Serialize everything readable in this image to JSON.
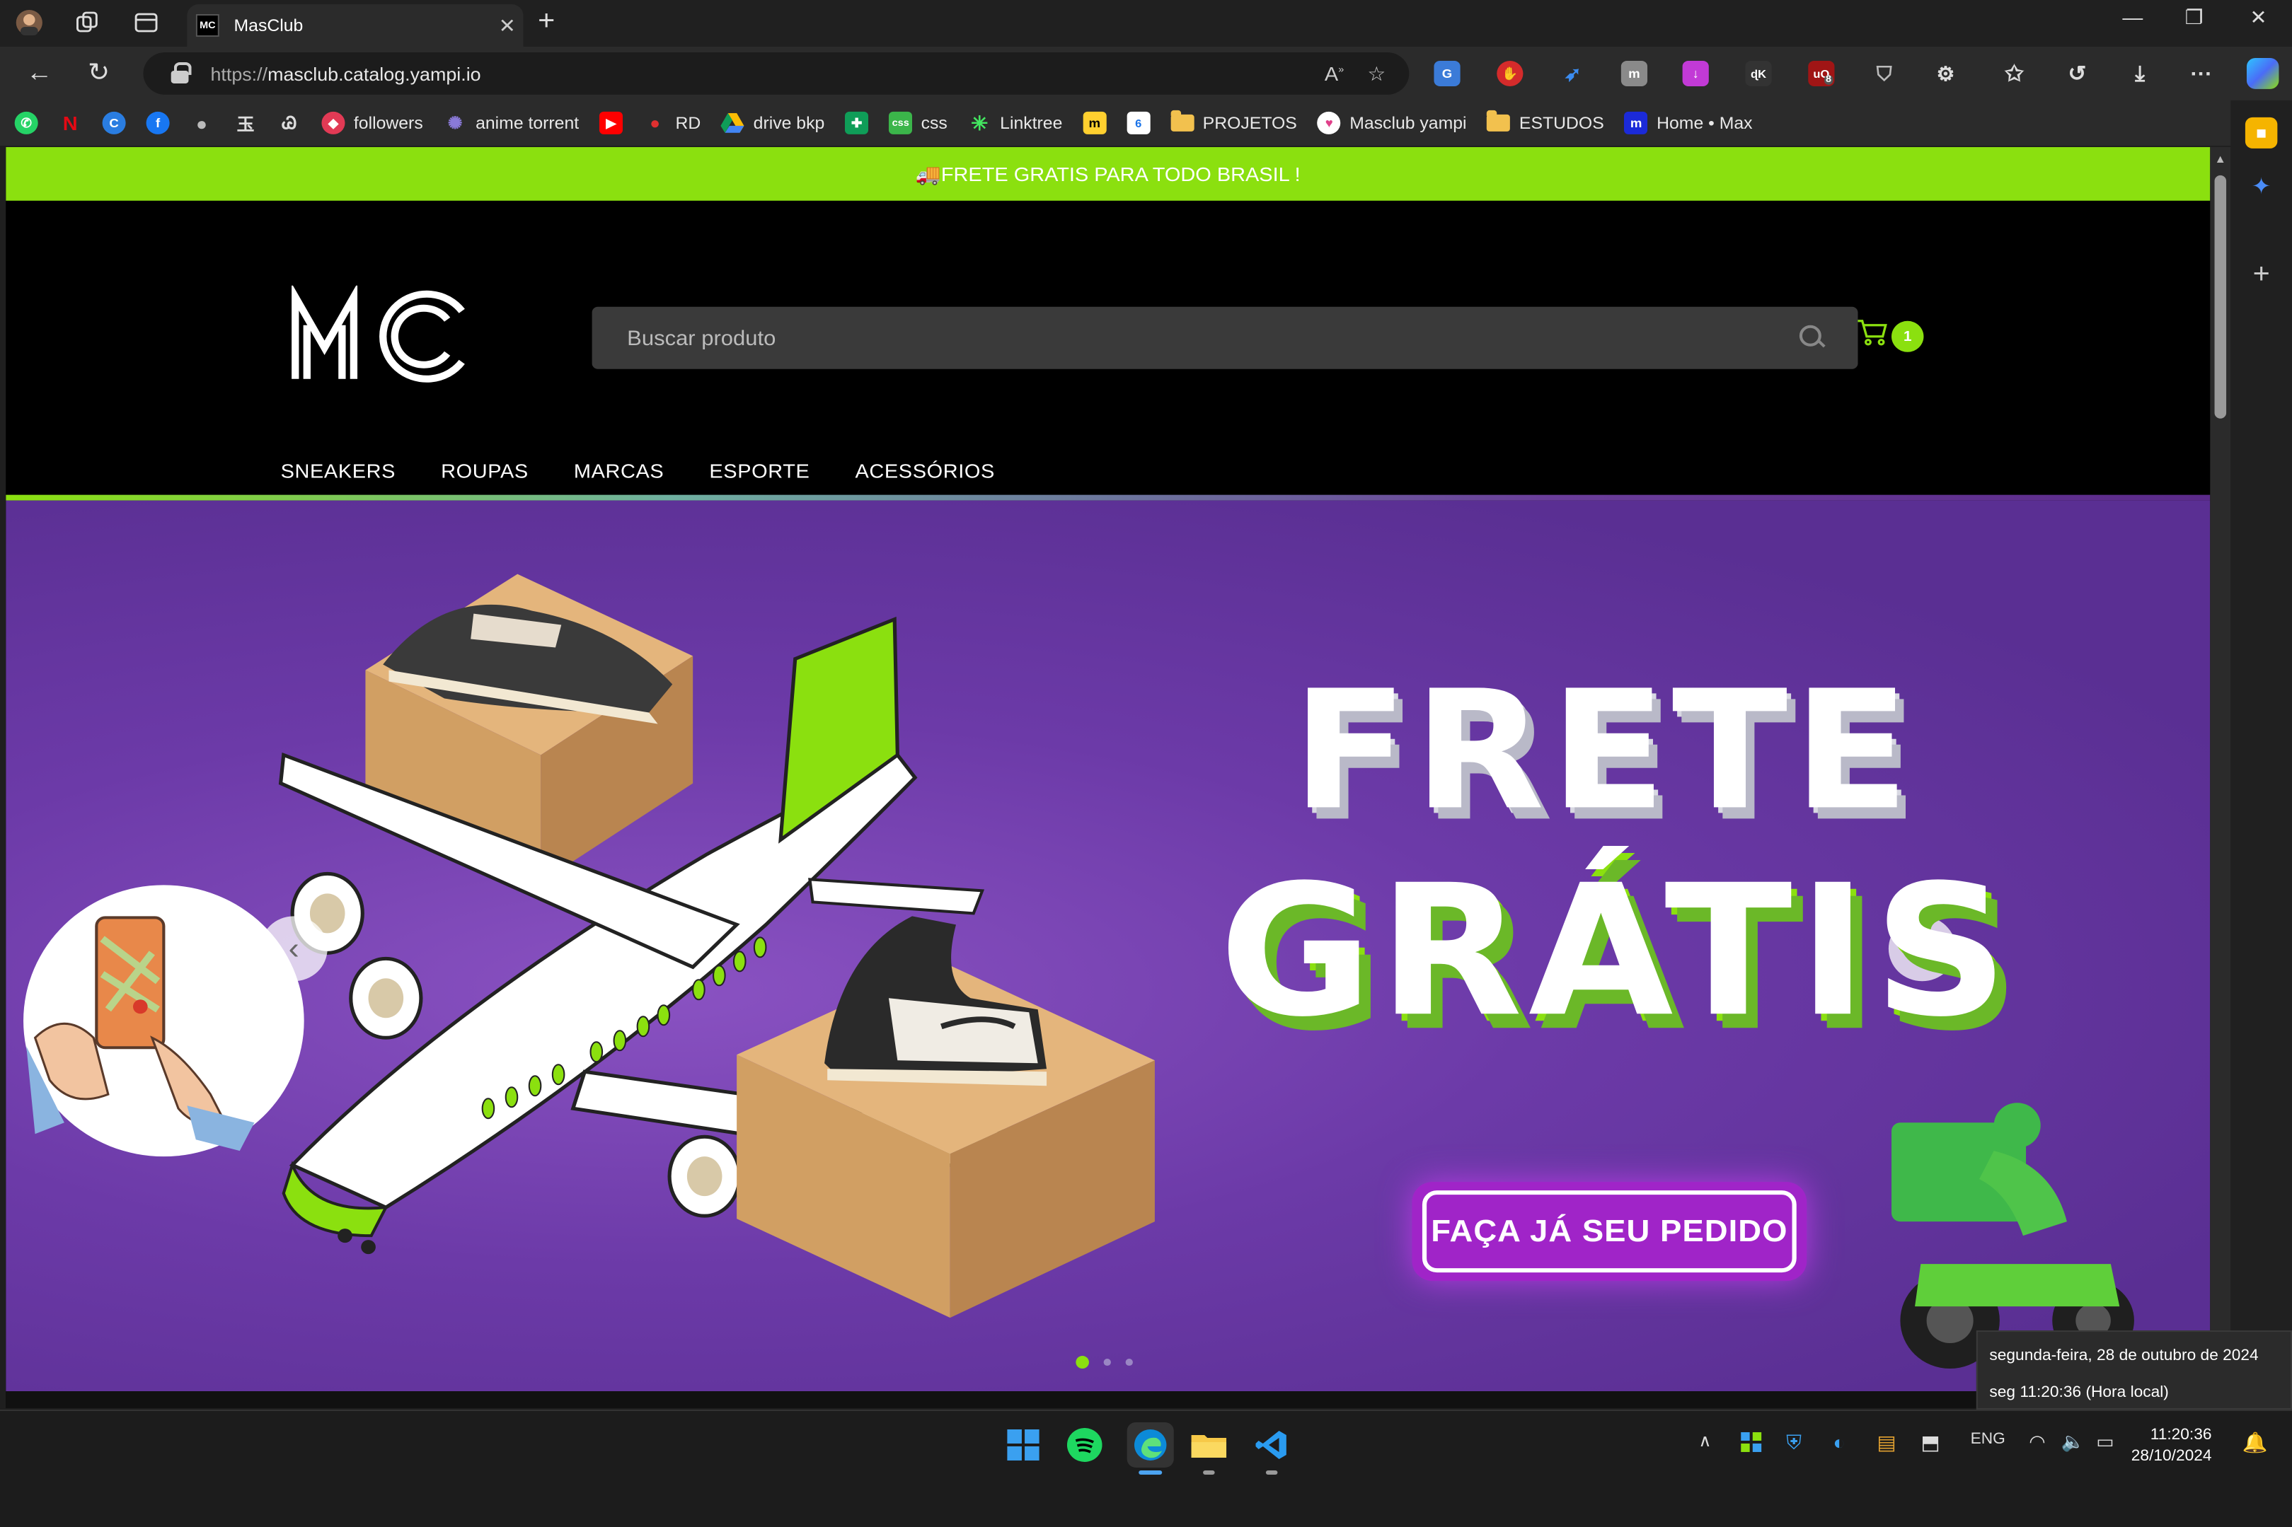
{
  "browser": {
    "tab_title": "MasClub",
    "tab_favicon": "MC",
    "url_protocol": "https://",
    "url_host": "masclub.catalog.yampi.io",
    "extension_badge": "8"
  },
  "bookmarks": {
    "followers": "followers",
    "anime": "anime torrent",
    "rd": "RD",
    "drive": "drive bkp",
    "css": "css",
    "linktree": "Linktree",
    "projetos": "PROJETOS",
    "masclub": "Masclub yampi",
    "estudos": "ESTUDOS",
    "home": "Home • Max"
  },
  "site": {
    "promo": "🚚FRETE GRATIS PARA TODO BRASIL !",
    "search_placeholder": "Buscar produto",
    "cart_count": "1",
    "menu": [
      "SNEAKERS",
      "ROUPAS",
      "MARCAS",
      "ESPORTE",
      "ACESSÓRIOS"
    ],
    "hero": {
      "line1": "FRETE",
      "line2": "GRÁTIS",
      "cta": "FAÇA JÁ SEU PEDIDO",
      "slides": 3,
      "active_slide": 1
    }
  },
  "taskbar": {
    "lang": "ENG",
    "time": "11:20:36",
    "date": "28/10/2024",
    "tooltip_date": "segunda-feira, 28 de outubro de 2024",
    "tooltip_time": "seg 11:20:36 (Hora local)"
  },
  "colors": {
    "accent_green": "#8be00f",
    "hero_purple": "#6c3aa8",
    "cta_purple": "#a024c8"
  }
}
